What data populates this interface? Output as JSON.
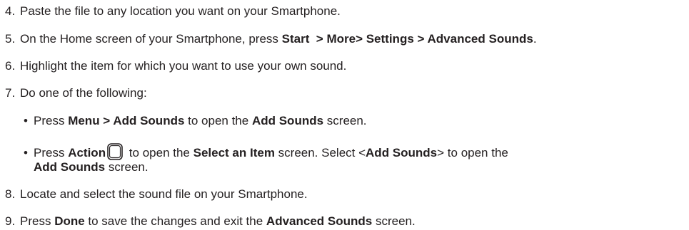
{
  "steps": {
    "s4": {
      "num": "4.",
      "text": "Paste the file to any location you want on your Smartphone."
    },
    "s5": {
      "num": "5.",
      "pre": "On the Home screen of your Smartphone, press ",
      "bold": "Start  > More> Settings > Advanced Sounds",
      "post": "."
    },
    "s6": {
      "num": "6.",
      "text": "Highlight the item for which you want to use your own sound."
    },
    "s7": {
      "num": "7.",
      "text": "Do one of the following:"
    },
    "s8": {
      "num": "8.",
      "text": "Locate and select the sound file on your Smartphone."
    },
    "s9": {
      "num": "9.",
      "pre": "Press ",
      "bold1": "Done",
      "mid": " to save the changes and exit the ",
      "bold2": "Advanced Sounds",
      "post": " screen."
    }
  },
  "bullets": {
    "b1": {
      "symbol": "•",
      "pre": "Press ",
      "bold1": "Menu > Add Sounds",
      "mid": " to open the ",
      "bold2": "Add Sounds",
      "post": " screen."
    },
    "b2": {
      "symbol": "•",
      "pre": "Press ",
      "bold1": "Action",
      "icon": "action-button-icon",
      "mid": " to open the ",
      "bold2": "Select an Item",
      "mid2": " screen. Select <",
      "bold3": "Add Sounds",
      "post": "> to open the",
      "line2_bold": "Add Sounds",
      "line2_post": " screen."
    }
  }
}
